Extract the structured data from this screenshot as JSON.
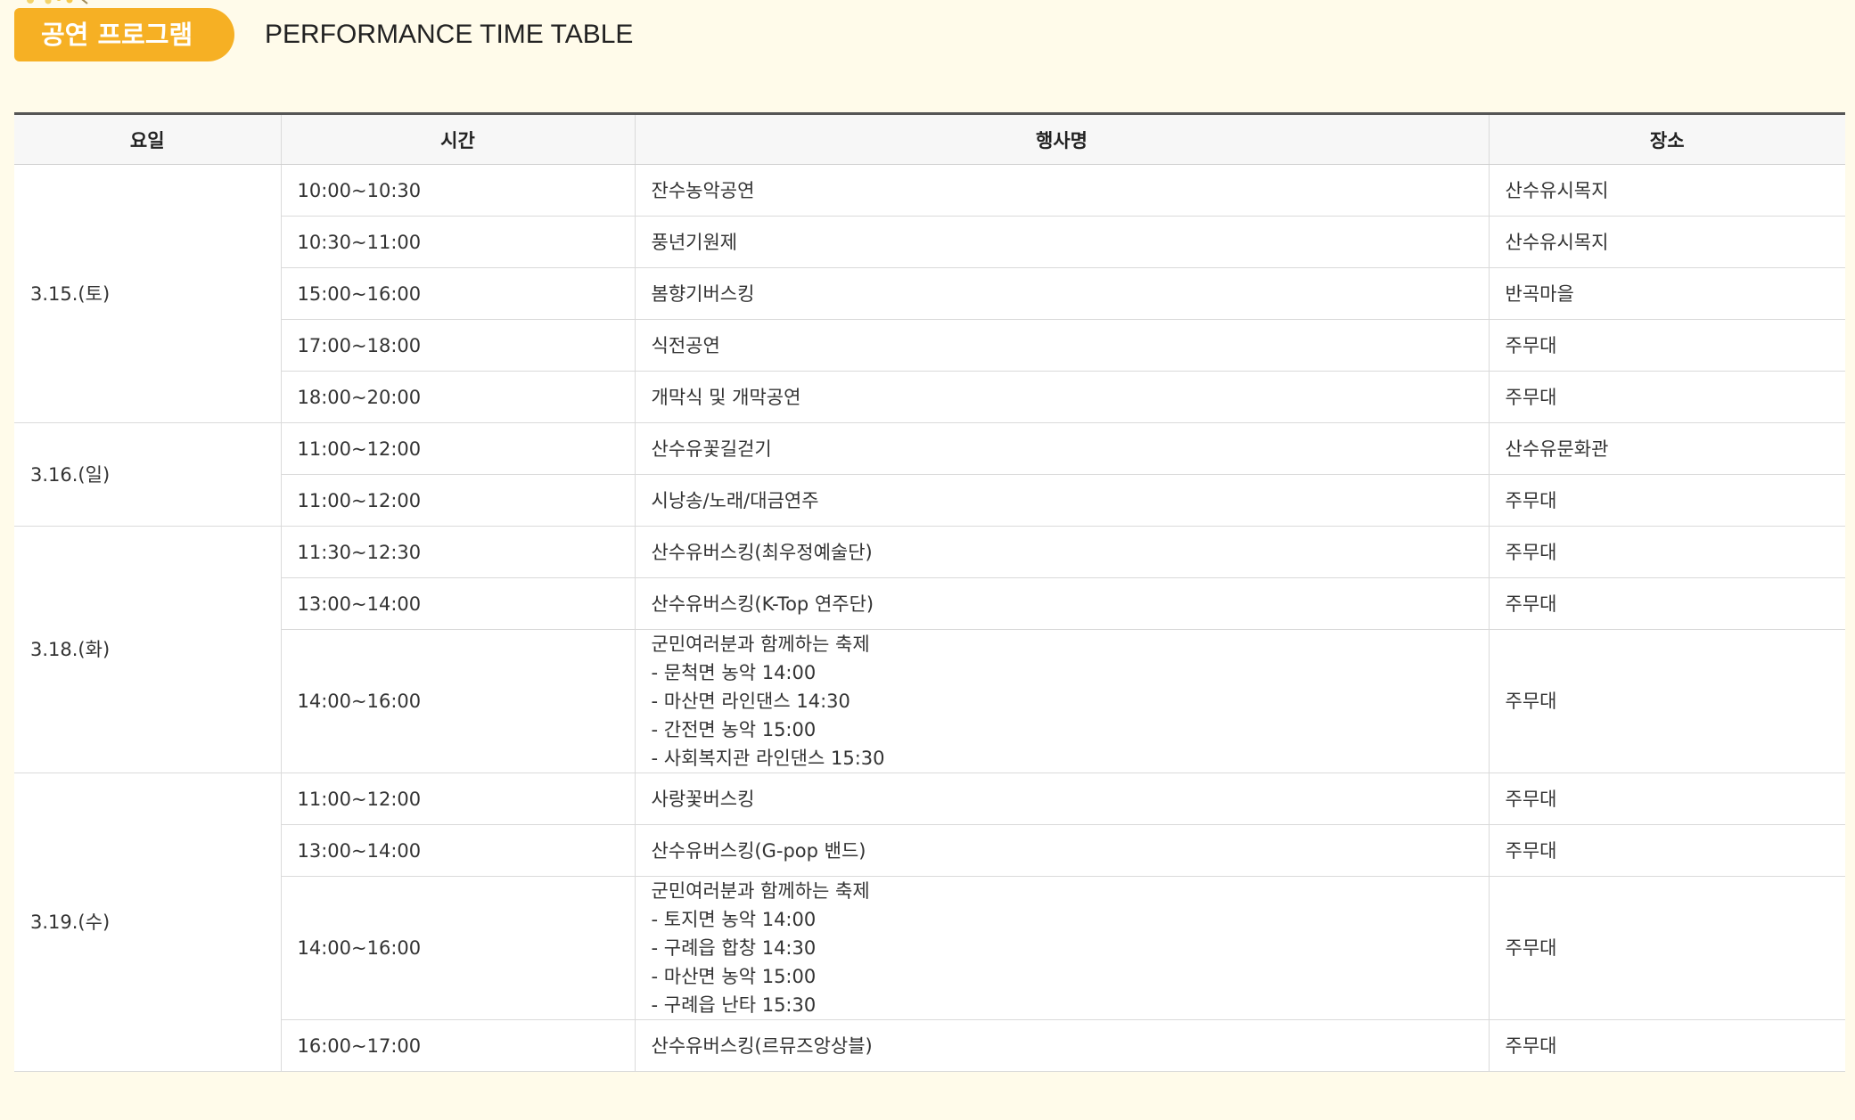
{
  "header": {
    "badge": "공연 프로그램",
    "subtitle": "PERFORMANCE TIME TABLE"
  },
  "colors": {
    "page_background": "#fffbea",
    "badge_background": "#f6b024",
    "table_header_background": "#f7f7f7",
    "top_rule": "#555555"
  },
  "table": {
    "headers": [
      "요일",
      "시간",
      "행사명",
      "장소"
    ],
    "days": [
      {
        "day": "3.15.(토)",
        "rows": [
          {
            "time": "10:00~10:30",
            "event": [
              "잔수농악공연"
            ],
            "place": "산수유시목지"
          },
          {
            "time": "10:30~11:00",
            "event": [
              "풍년기원제"
            ],
            "place": "산수유시목지"
          },
          {
            "time": "15:00~16:00",
            "event": [
              "봄향기버스킹"
            ],
            "place": "반곡마을"
          },
          {
            "time": "17:00~18:00",
            "event": [
              "식전공연"
            ],
            "place": "주무대"
          },
          {
            "time": "18:00~20:00",
            "event": [
              "개막식 및 개막공연"
            ],
            "place": "주무대"
          }
        ]
      },
      {
        "day": "3.16.(일)",
        "rows": [
          {
            "time": "11:00~12:00",
            "event": [
              "산수유꽃길걷기"
            ],
            "place": "산수유문화관"
          },
          {
            "time": "11:00~12:00",
            "event": [
              "시낭송/노래/대금연주"
            ],
            "place": "주무대"
          }
        ]
      },
      {
        "day": "3.18.(화)",
        "rows": [
          {
            "time": "11:30~12:30",
            "event": [
              "산수유버스킹(최우정예술단)"
            ],
            "place": "주무대"
          },
          {
            "time": "13:00~14:00",
            "event": [
              "산수유버스킹(K-Top 연주단)"
            ],
            "place": "주무대"
          },
          {
            "time": "14:00~16:00",
            "event": [
              "군민여러분과 함께하는 축제",
              "- 문척면 농악 14:00",
              "- 마산면 라인댄스 14:30",
              "- 간전면 농악 15:00",
              "- 사회복지관 라인댄스 15:30"
            ],
            "place": "주무대"
          }
        ]
      },
      {
        "day": "3.19.(수)",
        "rows": [
          {
            "time": "11:00~12:00",
            "event": [
              "사랑꽃버스킹"
            ],
            "place": "주무대"
          },
          {
            "time": "13:00~14:00",
            "event": [
              "산수유버스킹(G-pop 밴드)"
            ],
            "place": "주무대"
          },
          {
            "time": "14:00~16:00",
            "event": [
              "군민여러분과 함께하는 축제",
              "- 토지면 농악 14:00",
              "- 구례읍 합창 14:30",
              "- 마산면 농악 15:00",
              "- 구례읍 난타 15:30"
            ],
            "place": "주무대"
          },
          {
            "time": "16:00~17:00",
            "event": [
              "산수유버스킹(르뮤즈앙상블)"
            ],
            "place": "주무대"
          }
        ]
      }
    ]
  }
}
